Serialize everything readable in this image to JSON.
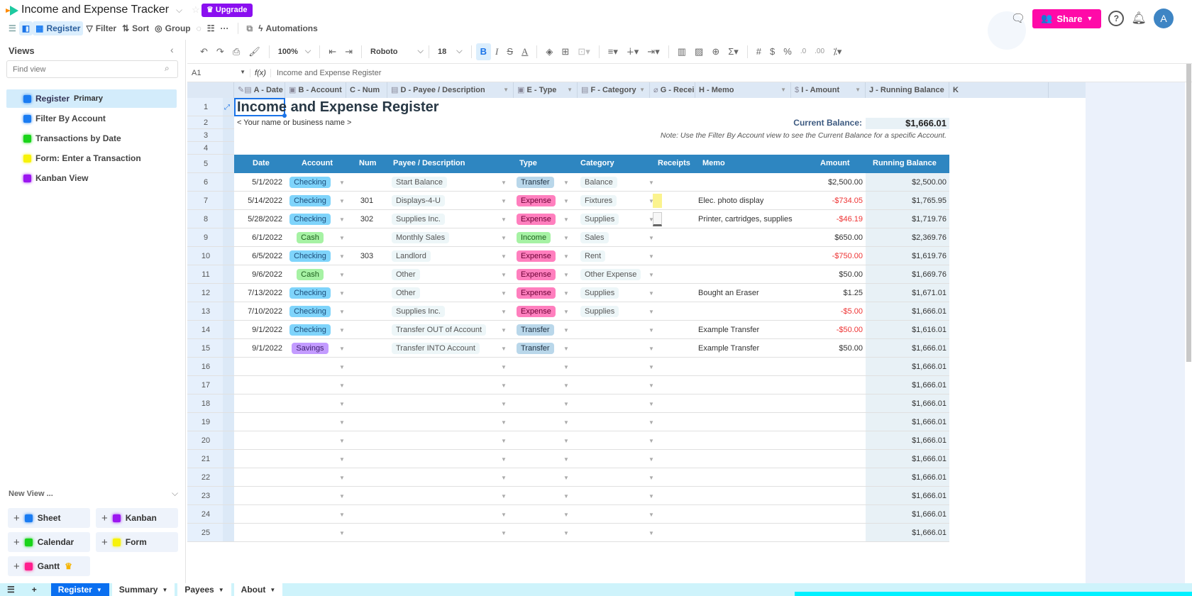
{
  "app": {
    "title": "Income and Expense Tracker",
    "upgrade_label": "Upgrade",
    "share_label": "Share",
    "avatar_initial": "A"
  },
  "viewbar": {
    "active_view": "Register",
    "filter": "Filter",
    "sort": "Sort",
    "group": "Group",
    "more": "···",
    "automations": "Automations"
  },
  "sidebar": {
    "heading": "Views",
    "find_placeholder": "Find view",
    "views": [
      {
        "label": "Register",
        "badge": "Primary",
        "icon": "grid-icon",
        "color": "#1a7cf2",
        "active": true
      },
      {
        "label": "Filter By Account",
        "icon": "grid-icon",
        "color": "#1a7cf2"
      },
      {
        "label": "Transactions by Date",
        "icon": "calendar-icon",
        "color": "#19d419"
      },
      {
        "label": "Form: Enter a Transaction",
        "icon": "form-icon",
        "color": "#f7f20a"
      },
      {
        "label": "Kanban View",
        "icon": "kanban-icon",
        "color": "#9b16f0"
      }
    ],
    "new_view_label": "New View ...",
    "new_view_buttons": [
      {
        "label": "Sheet",
        "color": "#1a7cf2"
      },
      {
        "label": "Kanban",
        "color": "#9b16f0"
      },
      {
        "label": "Calendar",
        "color": "#19d419"
      },
      {
        "label": "Form",
        "color": "#f7f20a"
      },
      {
        "label": "Gantt",
        "color": "#ff1f8e",
        "premium": true
      }
    ]
  },
  "toolbar": {
    "zoom": "100%",
    "font": "Roboto",
    "font_size": "18"
  },
  "formula_bar": {
    "cell_ref": "A1",
    "fx": "f(x)",
    "value": "Income and Expense Register"
  },
  "columns": [
    "A - Date",
    "B - Account",
    "C - Num",
    "D - Payee / Description",
    "E - Type",
    "F - Category",
    "G - Recei",
    "H - Memo",
    "I - Amount",
    "J - Running Balance",
    "K"
  ],
  "sheet": {
    "title": "Income and Expense Register",
    "subtitle": "< Your name or business name >",
    "current_balance_label": "Current Balance:",
    "current_balance": "$1,666.01",
    "note": "Note: Use the Filter By Account view to see the Current Balance for a specific Account.",
    "headers": [
      "Date",
      "Account",
      "Num",
      "Payee / Description",
      "Type",
      "Category",
      "Receipts",
      "Memo",
      "Amount",
      "Running Balance"
    ],
    "rows": [
      {
        "date": "5/1/2022",
        "account": "Checking",
        "num": "",
        "payee": "Start Balance",
        "type": "Transfer",
        "category": "Balance",
        "receipt": "",
        "memo": "",
        "amount": "$2,500.00",
        "neg": false,
        "balance": "$2,500.00"
      },
      {
        "date": "5/14/2022",
        "account": "Checking",
        "num": "301",
        "payee": "Displays-4-U",
        "type": "Expense",
        "category": "Fixtures",
        "receipt": "yellow",
        "memo": "Elec. photo display",
        "amount": "-$734.05",
        "neg": true,
        "balance": "$1,765.95"
      },
      {
        "date": "5/28/2022",
        "account": "Checking",
        "num": "302",
        "payee": "Supplies Inc.",
        "type": "Expense",
        "category": "Supplies",
        "receipt": "doc",
        "memo": "Printer, cartridges, supplies",
        "amount": "-$46.19",
        "neg": true,
        "balance": "$1,719.76"
      },
      {
        "date": "6/1/2022",
        "account": "Cash",
        "num": "",
        "payee": "Monthly Sales",
        "type": "Income",
        "category": "Sales",
        "receipt": "",
        "memo": "",
        "amount": "$650.00",
        "neg": false,
        "balance": "$2,369.76"
      },
      {
        "date": "6/5/2022",
        "account": "Checking",
        "num": "303",
        "payee": "Landlord",
        "type": "Expense",
        "category": "Rent",
        "receipt": "",
        "memo": "",
        "amount": "-$750.00",
        "neg": true,
        "balance": "$1,619.76"
      },
      {
        "date": "9/6/2022",
        "account": "Cash",
        "num": "",
        "payee": "Other",
        "type": "Expense",
        "category": "Other Expense",
        "receipt": "",
        "memo": "",
        "amount": "$50.00",
        "neg": false,
        "balance": "$1,669.76"
      },
      {
        "date": "7/13/2022",
        "account": "Checking",
        "num": "",
        "payee": "Other",
        "type": "Expense",
        "category": "Supplies",
        "receipt": "",
        "memo": "Bought an Eraser",
        "amount": "$1.25",
        "neg": false,
        "balance": "$1,671.01"
      },
      {
        "date": "7/10/2022",
        "account": "Checking",
        "num": "",
        "payee": "Supplies Inc.",
        "type": "Expense",
        "category": "Supplies",
        "receipt": "",
        "memo": "",
        "amount": "-$5.00",
        "neg": true,
        "balance": "$1,666.01"
      },
      {
        "date": "9/1/2022",
        "account": "Checking",
        "num": "",
        "payee": "Transfer OUT of Account",
        "type": "Transfer",
        "category": "",
        "receipt": "",
        "memo": "Example Transfer",
        "amount": "-$50.00",
        "neg": true,
        "balance": "$1,616.01"
      },
      {
        "date": "9/1/2022",
        "account": "Savings",
        "num": "",
        "payee": "Transfer INTO Account",
        "type": "Transfer",
        "category": "",
        "receipt": "",
        "memo": "Example Transfer",
        "amount": "$50.00",
        "neg": false,
        "balance": "$1,666.01"
      }
    ],
    "empty_row_balance": "$1,666.01",
    "empty_rows": 10
  },
  "bottom_tabs": [
    "Register",
    "Summary",
    "Payees",
    "About"
  ]
}
